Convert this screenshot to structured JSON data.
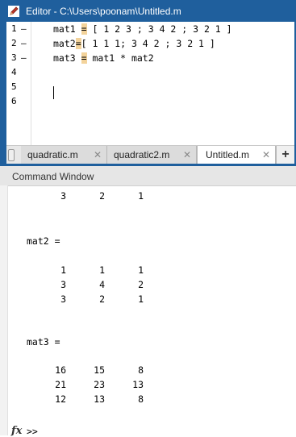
{
  "editor": {
    "title": "Editor - C:\\Users\\poonam\\Untitled.m",
    "line_numbers": [
      "1",
      "2",
      "3",
      "4",
      "5",
      "6"
    ],
    "line_marks": [
      "–",
      "–",
      "–"
    ],
    "code": {
      "l1_a": "mat1 ",
      "l1_eq": "=",
      "l1_b": " [ 1 2 3 ; 3 4 2 ; 3 2 1 ]",
      "l2_a": "mat2",
      "l2_eq": "=",
      "l2_b": "[ 1 1 1; 3 4 2 ; 3 2 1 ]",
      "l3_a": "mat3 ",
      "l3_eq": "=",
      "l3_b": " mat1 * mat2"
    },
    "tabs": [
      {
        "label": "quadratic.m"
      },
      {
        "label": "quadratic2.m"
      },
      {
        "label": "Untitled.m"
      }
    ],
    "add_tab_label": "+",
    "close_glyph": "✕"
  },
  "command_window": {
    "title": "Command Window",
    "partial_row": [
      "3",
      "2",
      "1"
    ],
    "mat2_label": "mat2 =",
    "mat2": [
      [
        "1",
        "1",
        "1"
      ],
      [
        "3",
        "4",
        "2"
      ],
      [
        "3",
        "2",
        "1"
      ]
    ],
    "mat3_label": "mat3 =",
    "mat3": [
      [
        "16",
        "15",
        "8"
      ],
      [
        "21",
        "23",
        "13"
      ],
      [
        "12",
        "13",
        "8"
      ]
    ],
    "fx_label": "fx",
    "prompt": ">>"
  },
  "colors": {
    "title_bar": "#1f5f9d",
    "equals_highlight": "#f3d39b"
  }
}
